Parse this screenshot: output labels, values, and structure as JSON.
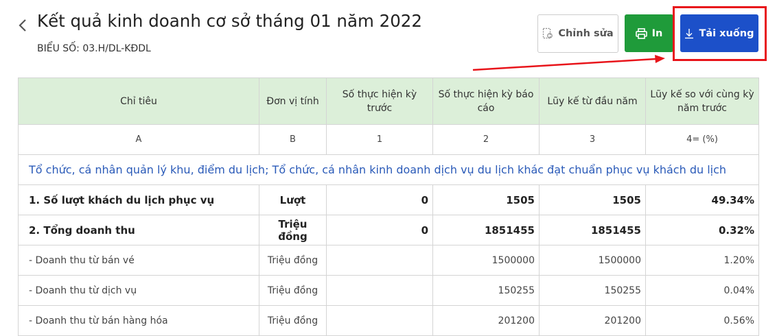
{
  "header": {
    "title": "Kết quả kinh doanh cơ sở tháng 01 năm 2022",
    "subtitle": "BIỂU SỐ: 03.H/DL-KĐDL"
  },
  "toolbar": {
    "edit_label": "Chỉnh sửa",
    "print_label": "In",
    "download_label": "Tải xuống"
  },
  "colors": {
    "header_bg": "#dcefd9",
    "print_button": "#1f9b3a",
    "download_button": "#1c50c9",
    "highlight": "#e8141a",
    "group_text": "#2a5ab8"
  },
  "table": {
    "headers": [
      "Chỉ tiêu",
      "Đơn vị tính",
      "Số thực hiện kỳ trước",
      "Số thực hiện kỳ báo cáo",
      "Lũy kế từ đầu năm",
      "Lũy kế so với cùng kỳ năm trước"
    ],
    "index_row": [
      "A",
      "B",
      "1",
      "2",
      "3",
      "4= (%)"
    ],
    "group_label": "Tổ chức, cá nhân quản lý khu, điểm du lịch; Tổ chức, cá nhân kinh doanh dịch vụ du lịch khác đạt chuẩn phục vụ khách du lịch",
    "rows": [
      {
        "name": "1. Số lượt khách du lịch phục vụ",
        "unit": "Lượt",
        "prev": "0",
        "current": "1505",
        "ytd": "1505",
        "pct": "49.34%"
      },
      {
        "name": "2. Tổng doanh thu",
        "unit": "Triệu đồng",
        "prev": "0",
        "current": "1851455",
        "ytd": "1851455",
        "pct": "0.32%"
      },
      {
        "name": "- Doanh thu từ bán vé",
        "unit": "Triệu đồng",
        "prev": "",
        "current": "1500000",
        "ytd": "1500000",
        "pct": "1.20%"
      },
      {
        "name": "- Doanh thu từ dịch vụ",
        "unit": "Triệu đồng",
        "prev": "",
        "current": "150255",
        "ytd": "150255",
        "pct": "0.04%"
      },
      {
        "name": "- Doanh thu từ bán hàng hóa",
        "unit": "Triệu đồng",
        "prev": "",
        "current": "201200",
        "ytd": "201200",
        "pct": "0.56%"
      }
    ]
  }
}
